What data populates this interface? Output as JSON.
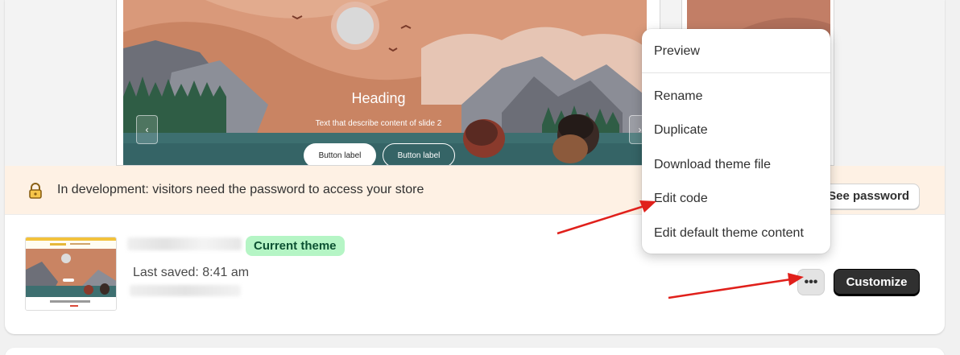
{
  "slide": {
    "heading": "Heading",
    "text": "Text that describe content of slide 2",
    "button_primary": "Button label",
    "button_secondary": "Button label",
    "prev_arrow": "‹",
    "next_arrow": "›"
  },
  "banner": {
    "icon": "lock-icon",
    "text": "In development: visitors need the password to access your store",
    "button_label": "See password"
  },
  "theme": {
    "badge": "Current theme",
    "last_saved": "Last saved: 8:41 am",
    "more_label": "•••",
    "customize_label": "Customize"
  },
  "menu": {
    "items": [
      "Preview",
      "Rename",
      "Duplicate",
      "Download theme file",
      "Edit code",
      "Edit default theme content"
    ]
  },
  "colors": {
    "banner_bg": "#fef1e4",
    "badge_bg": "#b5f5c5",
    "badge_text": "#0c5132",
    "primary_button": "#303030",
    "annotation_arrow": "#e0201b"
  }
}
